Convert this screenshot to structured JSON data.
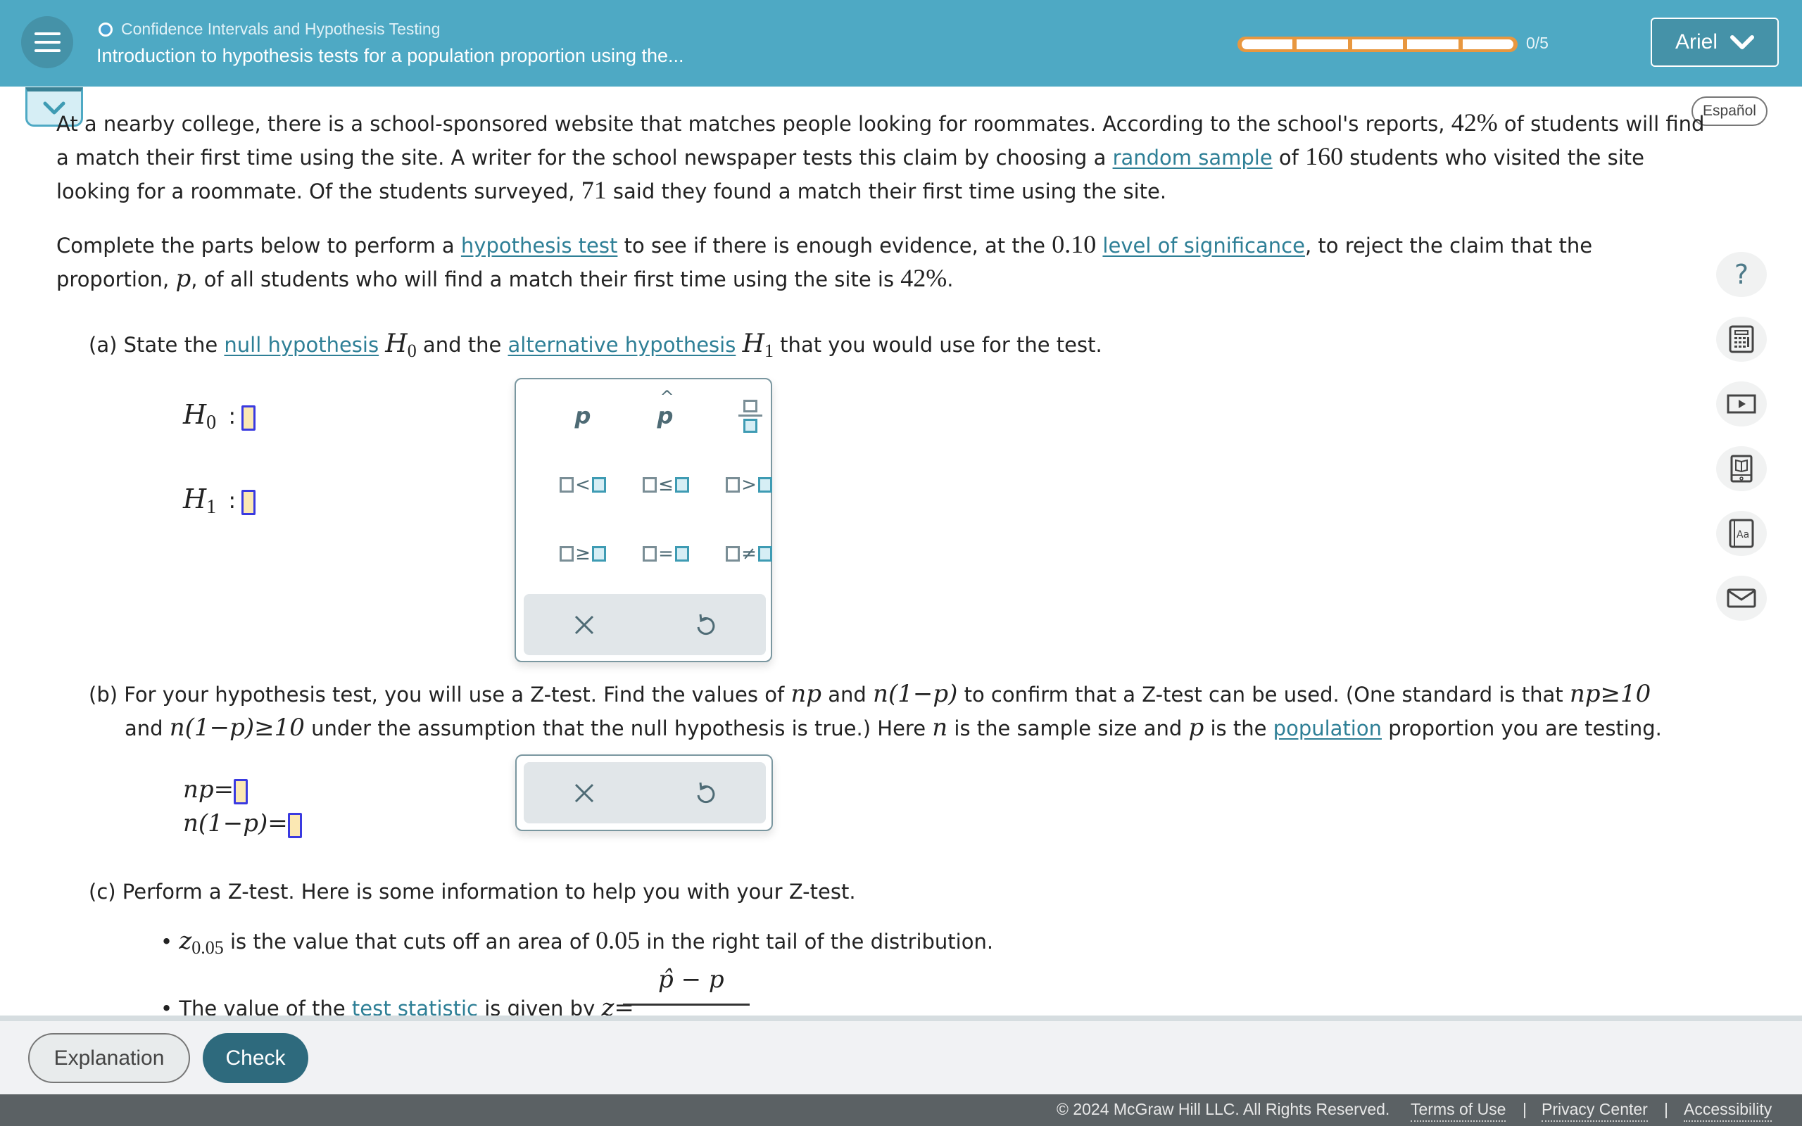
{
  "header": {
    "breadcrumb": "Confidence Intervals and Hypothesis Testing",
    "title": "Introduction to hypothesis tests for a population proportion using the...",
    "progress": {
      "completed": 0,
      "total": 5,
      "label": "0/5"
    },
    "user_name": "Ariel",
    "colors": {
      "header_bg": "#4ea9c4",
      "progress": "#e8973f",
      "accent": "#2e6a7d",
      "link": "#2e7f96"
    }
  },
  "language_button": "Español",
  "problem": {
    "p1": {
      "t1": "At a nearby college, there is a school-sponsored website that matches people looking for roommates. According to the school's reports, ",
      "v1": "42%",
      "t2": " of students will find",
      "t3": "a match their first time using the site. A writer for the school newspaper tests this claim by choosing a ",
      "link1": "random sample",
      "t4": " of ",
      "v2": "160",
      "t5": " students who visited the site",
      "t6": "looking for a roommate. Of the students surveyed, ",
      "v3": "71",
      "t7": " said they found a match their first time using the site."
    },
    "p2": {
      "t1": "Complete the parts below to perform a ",
      "link1": "hypothesis test",
      "t2": " to see if there is enough evidence, at the ",
      "v1": "0.10",
      "t3": " ",
      "link2": "level of significance",
      "t4": ", to reject the claim that the",
      "t5": "proportion, ",
      "var": "p",
      "t6": ", of all students who will find a match their first time using the site is ",
      "v2": "42%",
      "t7": "."
    }
  },
  "part_a": {
    "t1": "(a) State the ",
    "link1": "null hypothesis",
    "h0": "H",
    "h0_sub": "0",
    "t2": " and the ",
    "link2": "alternative hypothesis",
    "h1": "H",
    "h1_sub": "1",
    "t3": " that you would use for the test.",
    "rows": [
      {
        "label": "H",
        "sub": "0",
        "colon": ":",
        "value": ""
      },
      {
        "label": "H",
        "sub": "1",
        "colon": ":",
        "value": ""
      }
    ],
    "keypad": {
      "keys": [
        "p",
        "p̂",
        "fraction",
        "<",
        "≤",
        ">",
        "≥",
        "=",
        "≠"
      ],
      "actions": [
        "clear",
        "undo"
      ]
    }
  },
  "part_b": {
    "l1a": "(b) For your hypothesis test, you will use a Z-test. Find the values of ",
    "np": "np",
    "and": " and ",
    "n1p": "n(1−p)",
    "l1b": " to confirm that a Z-test can be used. (One standard is that ",
    "np_cond": "np≥10",
    "l2a": "and ",
    "n1p_cond": "n(1−p)≥10",
    "l2b": " under the assumption that the null hypothesis is true.) Here ",
    "n": "n",
    "l2c": " is the sample size and ",
    "p": "p",
    "l2d": " is the ",
    "link1": "population",
    "l2e": " proportion you are testing.",
    "rows": [
      {
        "label": "np=",
        "value": ""
      },
      {
        "label": "n(1−p)=",
        "value": ""
      }
    ],
    "keypad": {
      "actions": [
        "clear",
        "undo"
      ]
    }
  },
  "part_c": {
    "intro": "(c) Perform a Z-test. Here is some information to help you with your Z-test.",
    "b1_var": "z",
    "b1_sub": "0.05",
    "b1_text": " is the value that cuts off an area of ",
    "b1_val": "0.05",
    "b1_text2": " in the right tail of the distribution.",
    "b2_text": "The value of the ",
    "b2_link": "test statistic",
    "b2_text2": " is given by ",
    "b2_eq": "z=",
    "b2_num": "p̂ − p"
  },
  "sidebar_tools": [
    {
      "name": "help",
      "icon": "question-icon"
    },
    {
      "name": "calculator",
      "icon": "calculator-icon"
    },
    {
      "name": "video",
      "icon": "play-icon"
    },
    {
      "name": "ebook",
      "icon": "ebook-icon"
    },
    {
      "name": "glossary",
      "icon": "dictionary-icon"
    },
    {
      "name": "message",
      "icon": "mail-icon"
    }
  ],
  "bottom": {
    "explanation": "Explanation",
    "check": "Check"
  },
  "footer": {
    "copyright": "© 2024 McGraw Hill LLC. All Rights Reserved.",
    "terms": "Terms of Use",
    "privacy": "Privacy Center",
    "accessibility": "Accessibility",
    "sep": "|"
  }
}
